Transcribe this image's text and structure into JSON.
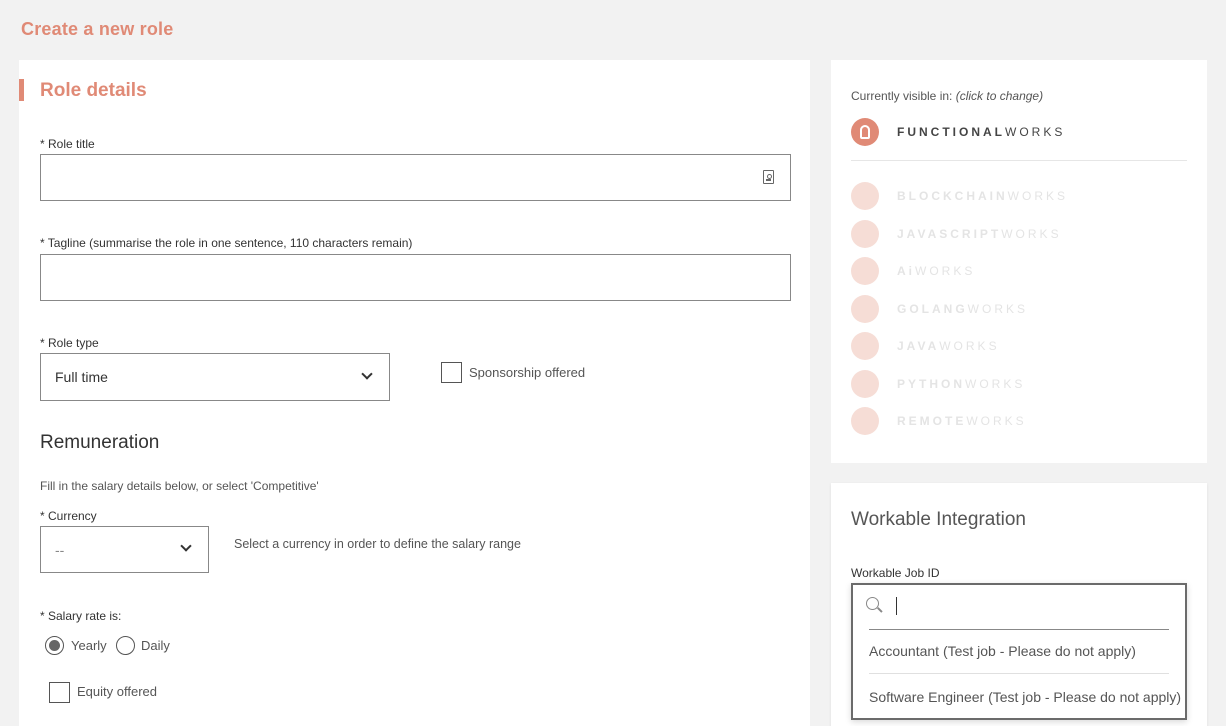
{
  "page": {
    "title": "Create a new role"
  },
  "role_details": {
    "section_title": "Role details",
    "role_title_label": "* Role title",
    "role_title_value": "",
    "tagline_label": "* Tagline (summarise the role in one sentence, 110 characters remain)",
    "tagline_value": "",
    "role_type_label": "* Role type",
    "role_type_value": "Full time",
    "sponsorship_label": "Sponsorship offered"
  },
  "remuneration": {
    "heading": "Remuneration",
    "hint": "Fill in the salary details below, or select 'Competitive'",
    "currency_label": "* Currency",
    "currency_value": "--",
    "currency_hint": "Select a currency in order to define the salary range",
    "salary_rate_label": "* Salary rate is:",
    "rate_yearly": "Yearly",
    "rate_daily": "Daily",
    "selected_rate": "Yearly",
    "equity_label": "Equity offered"
  },
  "visibility": {
    "label": "Currently visible in:",
    "label_hint": "(click to change)",
    "active": {
      "bold": "FUNCTIONAL",
      "light": "WORKS"
    },
    "others": [
      {
        "bold": "BLOCKCHAIN",
        "light": "WORKS"
      },
      {
        "bold": "JAVASCRIPT",
        "light": "WORKS"
      },
      {
        "bold": "Ai",
        "light": "WORKS"
      },
      {
        "bold": "GOLANG",
        "light": "WORKS"
      },
      {
        "bold": "JAVA",
        "light": "WORKS"
      },
      {
        "bold": "PYTHON",
        "light": "WORKS"
      },
      {
        "bold": "REMOTE",
        "light": "WORKS"
      }
    ],
    "accent_color": "#e08a76"
  },
  "workable": {
    "title": "Workable Integration",
    "job_id_label": "Workable Job ID",
    "search_value": "",
    "options": [
      "Accountant (Test job - Please do not apply)",
      "Software Engineer (Test job - Please do not apply)"
    ]
  }
}
